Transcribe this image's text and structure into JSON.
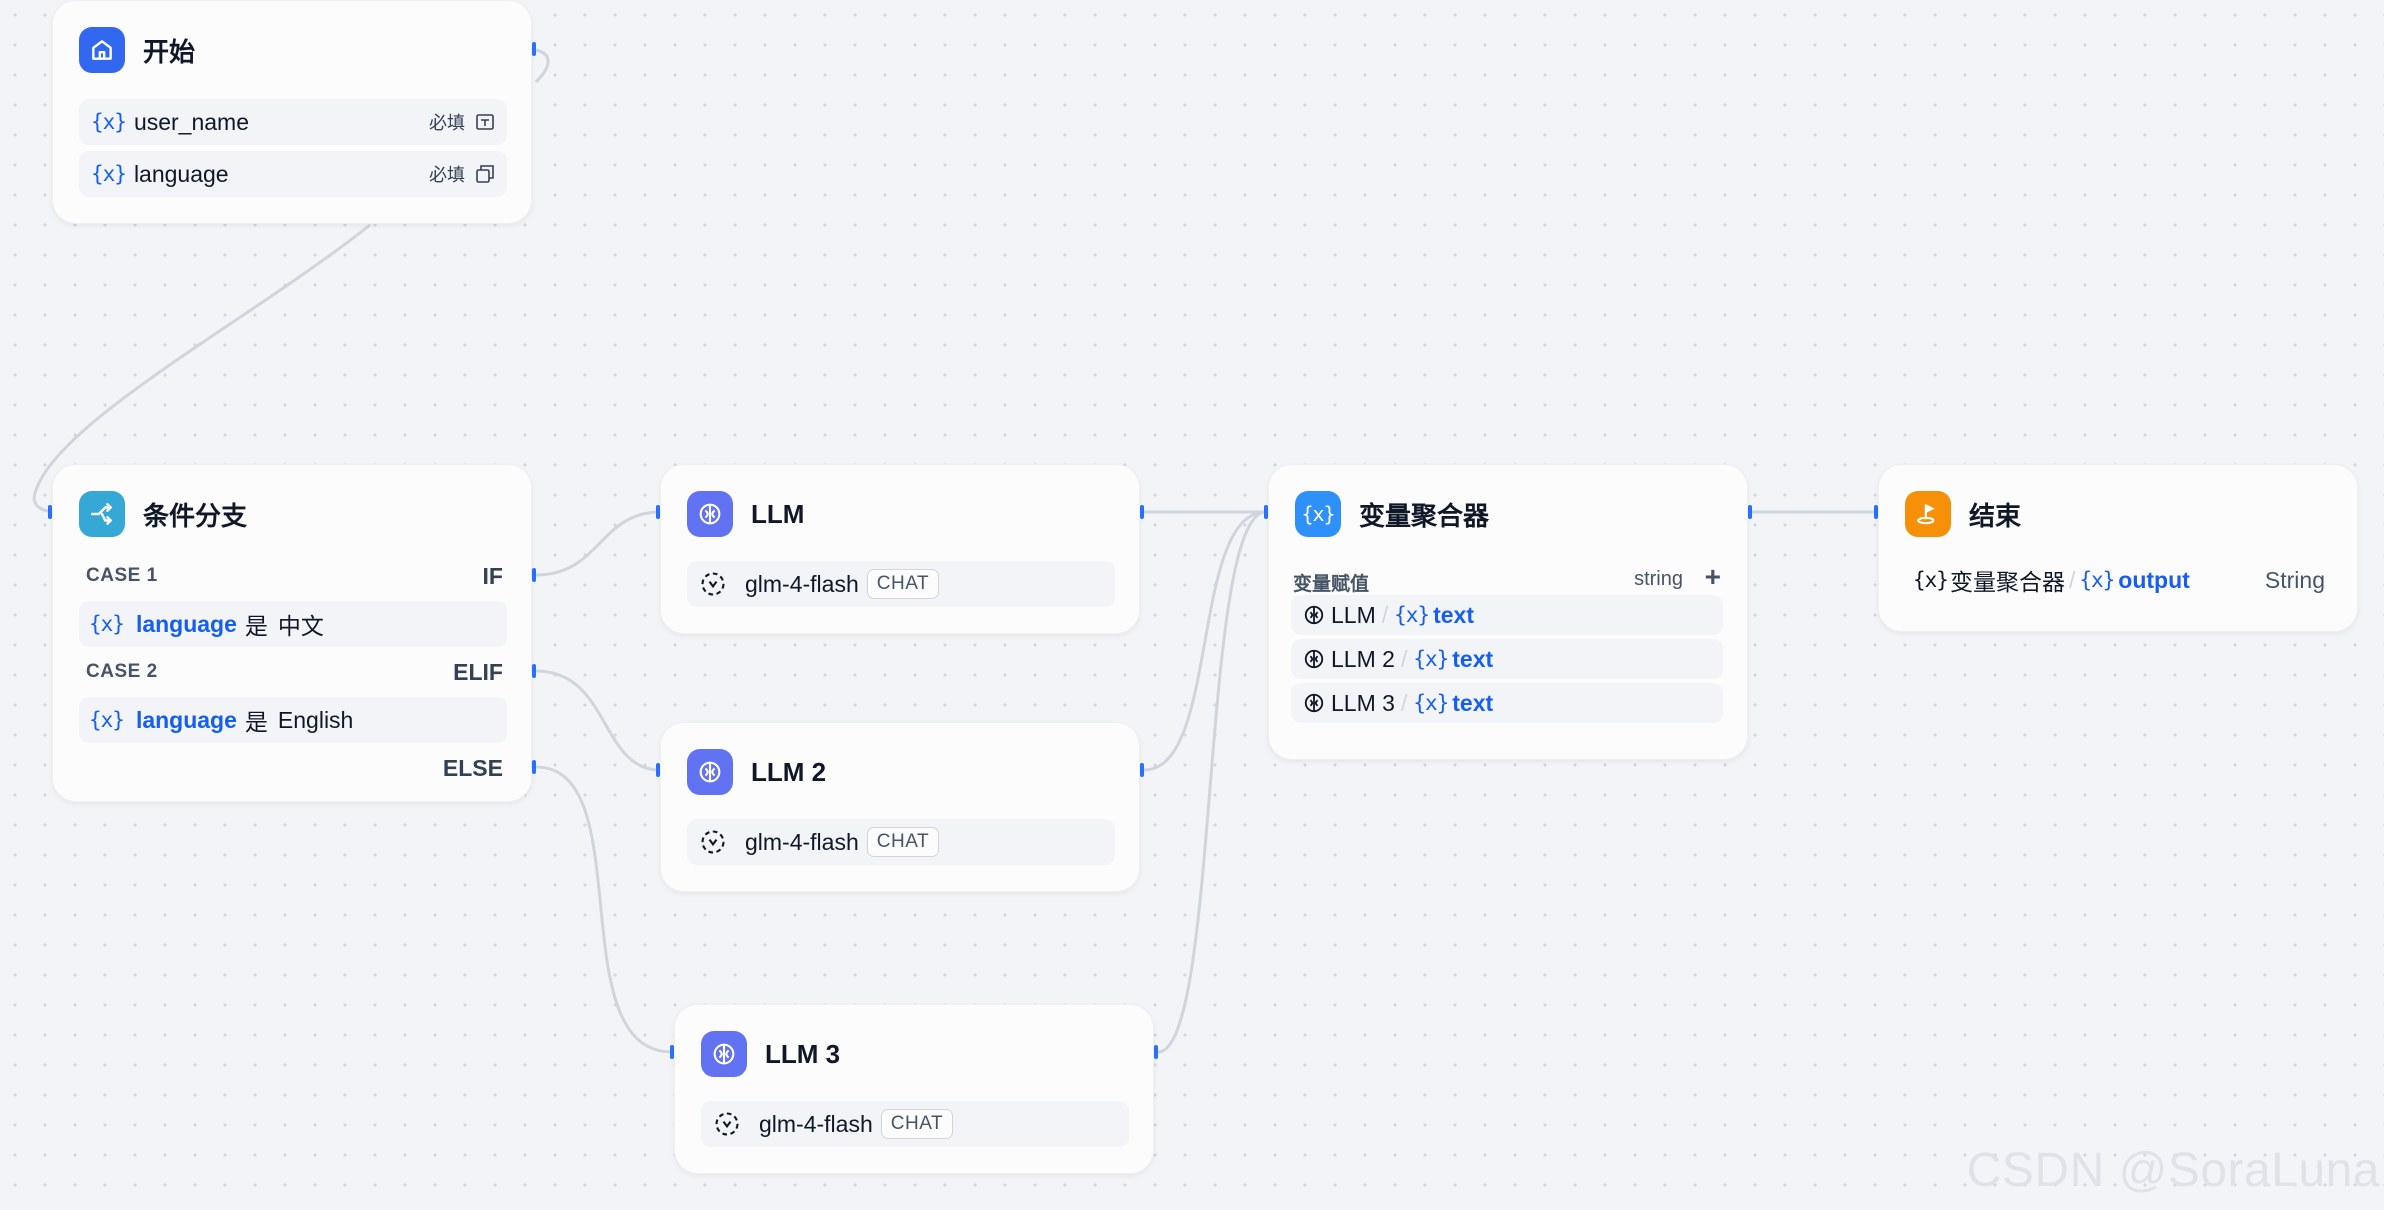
{
  "colors": {
    "start_icon": "#3268f0",
    "if_icon": "#36a8d6",
    "llm_icon": "#6172f3",
    "aggregator_icon": "#2e90fa",
    "end_icon": "#f79009",
    "accent_blue": "#155eef",
    "wire": "#d0d5dd",
    "handle": "#2970ff"
  },
  "start": {
    "title": "开始",
    "vars": [
      {
        "name": "user_name",
        "required": "必填",
        "icon": "text-input-icon"
      },
      {
        "name": "language",
        "required": "必填",
        "icon": "select-icon"
      }
    ]
  },
  "if_else": {
    "title": "条件分支",
    "cases": [
      {
        "label": "CASE 1",
        "branch": "IF",
        "variable": "language",
        "operator": "是",
        "value": "中文"
      },
      {
        "label": "CASE 2",
        "branch": "ELIF",
        "variable": "language",
        "operator": "是",
        "value": "English"
      }
    ],
    "else_label": "ELSE"
  },
  "llms": [
    {
      "title": "LLM",
      "model": "glm-4-flash",
      "mode": "CHAT"
    },
    {
      "title": "LLM 2",
      "model": "glm-4-flash",
      "mode": "CHAT"
    },
    {
      "title": "LLM 3",
      "model": "glm-4-flash",
      "mode": "CHAT"
    }
  ],
  "aggregator": {
    "title": "变量聚合器",
    "section_label": "变量赋值",
    "type": "string",
    "add": "+",
    "items": [
      {
        "node": "LLM",
        "sep": "/",
        "var": "text"
      },
      {
        "node": "LLM 2",
        "sep": "/",
        "var": "text"
      },
      {
        "node": "LLM 3",
        "sep": "/",
        "var": "text"
      }
    ]
  },
  "end": {
    "title": "结束",
    "output_node": "变量聚合器",
    "sep": "/",
    "output_var": "output",
    "output_type": "String"
  },
  "var_glyph": "{x}",
  "watermark": "CSDN @SoraLuna"
}
